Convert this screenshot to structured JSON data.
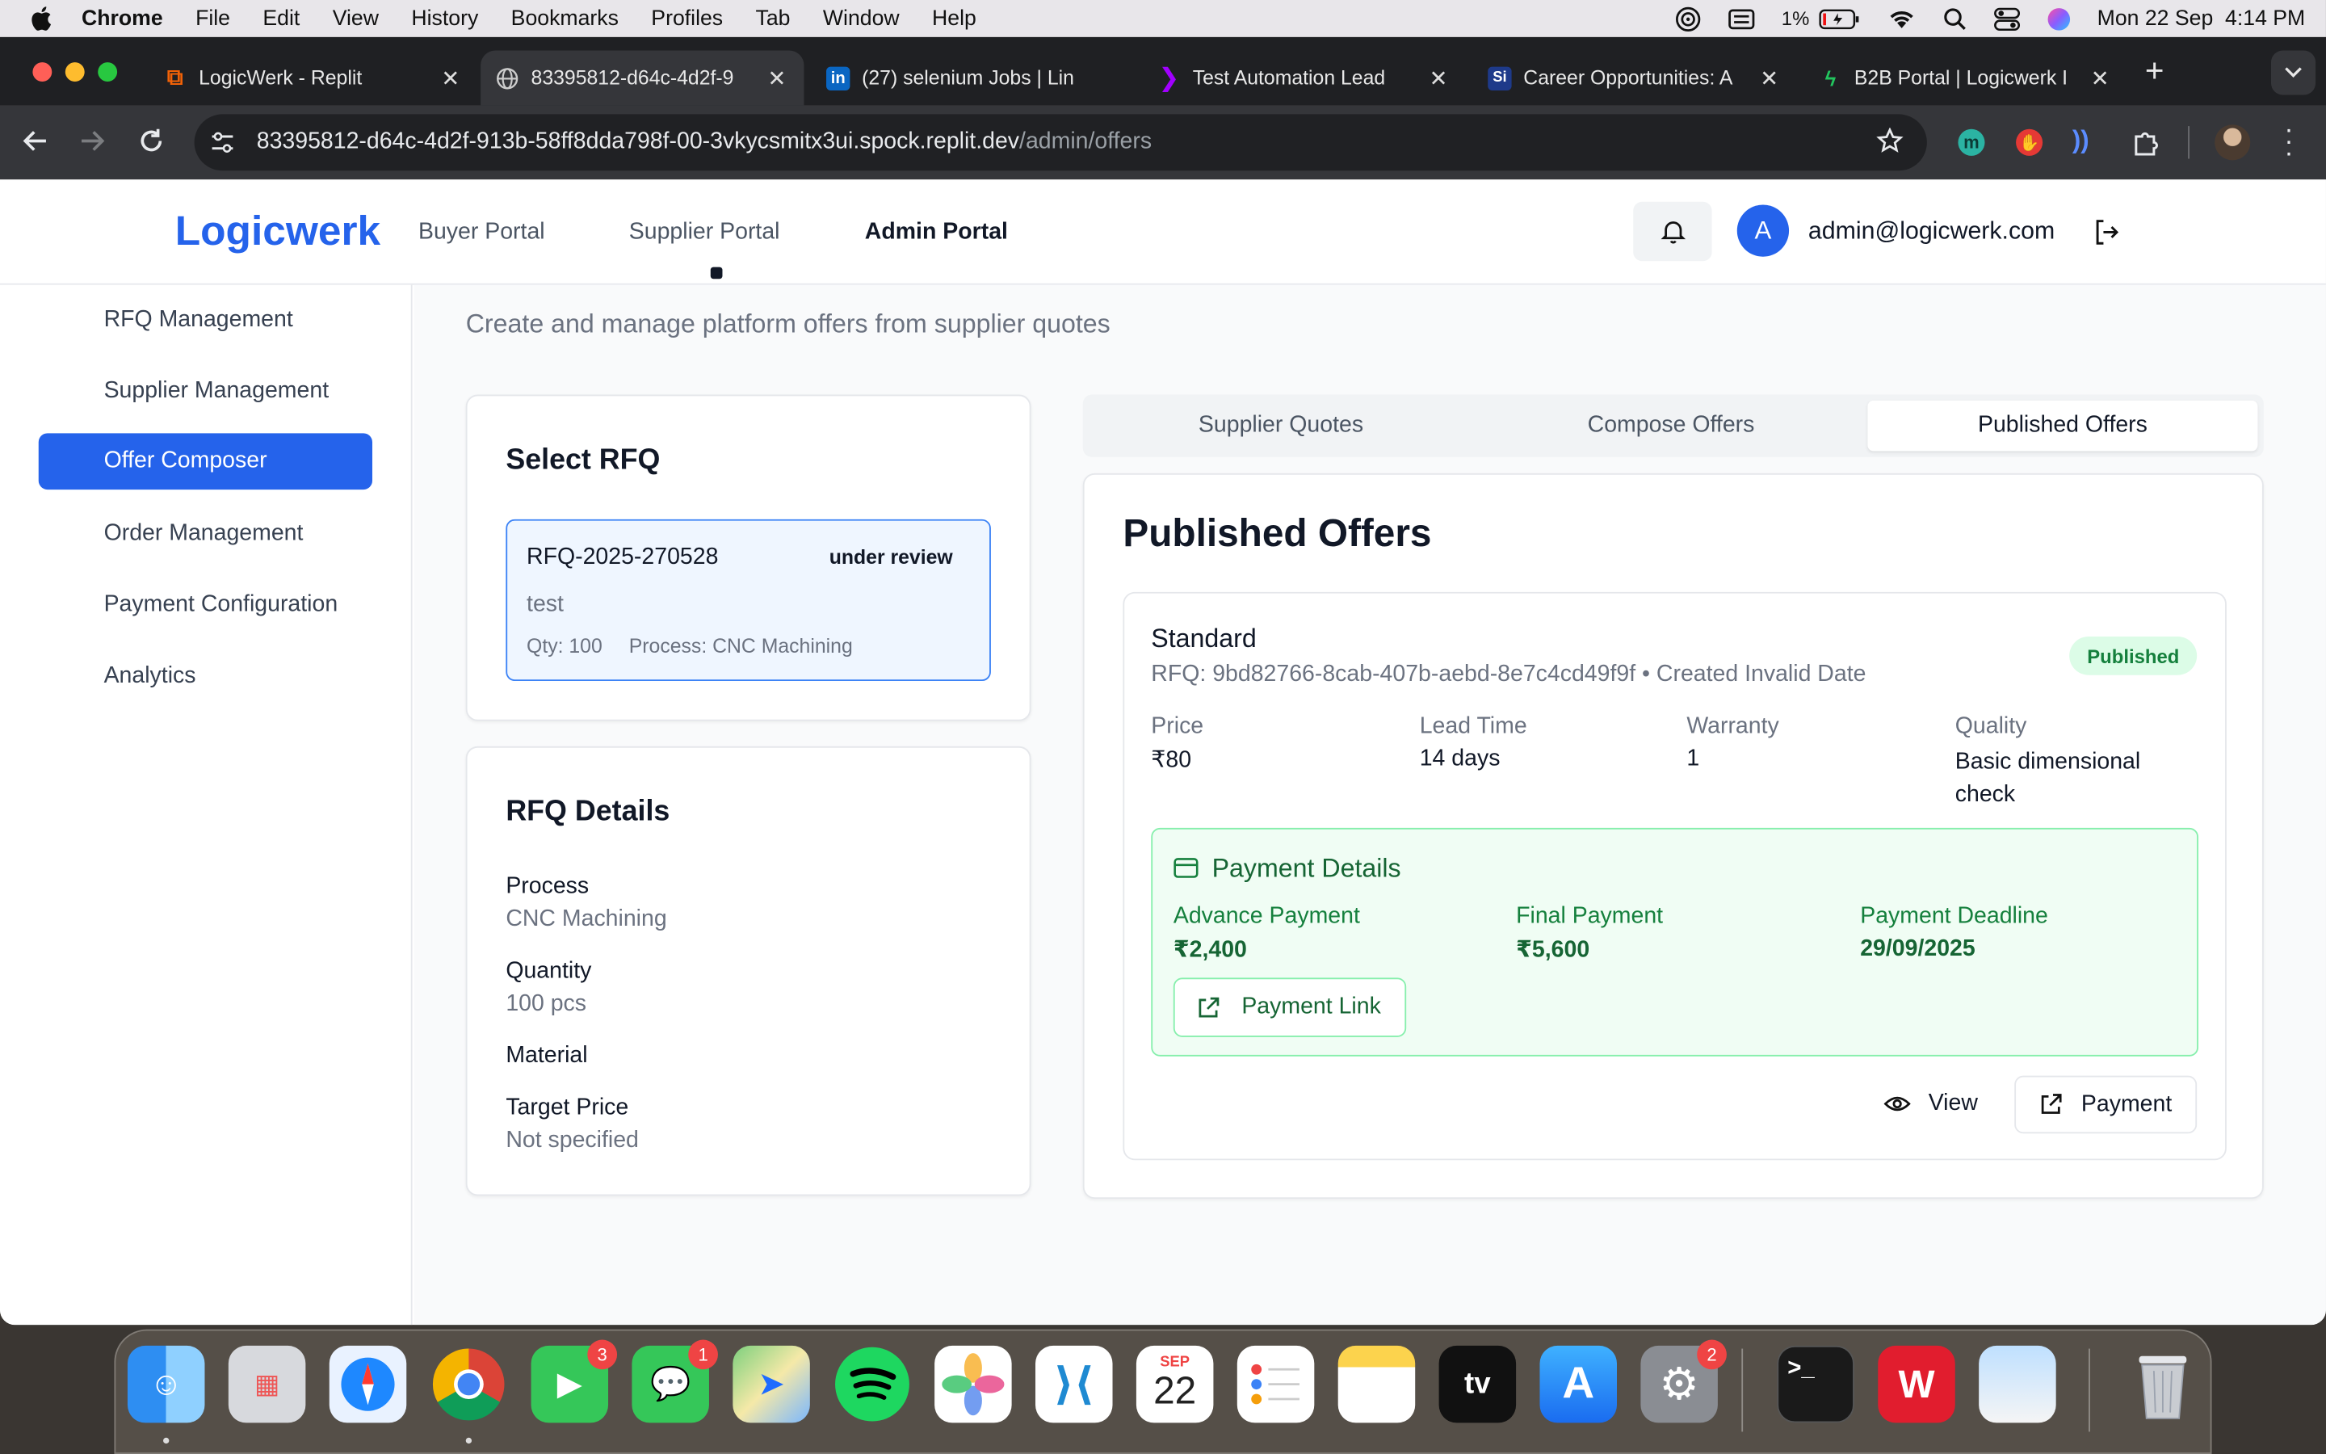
{
  "menubar": {
    "app": "Chrome",
    "items": [
      "File",
      "Edit",
      "View",
      "History",
      "Bookmarks",
      "Profiles",
      "Tab",
      "Window",
      "Help"
    ],
    "battery": "1%",
    "datetime": "Mon 22 Sep  4:14 PM"
  },
  "tabs": [
    {
      "title": "LogicWerk - Replit"
    },
    {
      "title": "83395812-d64c-4d2f-9"
    },
    {
      "title": "(27) selenium Jobs | Lin"
    },
    {
      "title": "Test Automation Lead"
    },
    {
      "title": "Career Opportunities: A"
    },
    {
      "title": "B2B Portal | Logicwerk I"
    }
  ],
  "address": {
    "host": "83395812-d64c-4d2f-913b-58ff8dda798f-00-3vkycsmitx3ui.spock.replit.dev",
    "path": "/admin/offers"
  },
  "header": {
    "brand": "Logicwerk",
    "nav": [
      "Buyer Portal",
      "Supplier Portal",
      "Admin Portal"
    ],
    "avatar_initial": "A",
    "user_email": "admin@logicwerk.com"
  },
  "sidebar": {
    "items": [
      {
        "label": "RFQ Management"
      },
      {
        "label": "Supplier Management"
      },
      {
        "label": "Offer Composer"
      },
      {
        "label": "Order Management"
      },
      {
        "label": "Payment Configuration"
      },
      {
        "label": "Analytics"
      }
    ]
  },
  "page": {
    "subtitle": "Create and manage platform offers from supplier quotes"
  },
  "select_rfq": {
    "title": "Select RFQ",
    "rfq_id": "RFQ-2025-270528",
    "status": "under review",
    "name": "test",
    "qty": "Qty: 100",
    "process": "Process: CNC Machining"
  },
  "rfq_details": {
    "title": "RFQ Details",
    "process_label": "Process",
    "process_value": "CNC Machining",
    "quantity_label": "Quantity",
    "quantity_value": "100 pcs",
    "material_label": "Material",
    "target_price_label": "Target Price",
    "target_price_value": "Not specified"
  },
  "tabs_main": [
    "Supplier Quotes",
    "Compose Offers",
    "Published Offers"
  ],
  "published": {
    "title": "Published Offers",
    "offer": {
      "name": "Standard",
      "meta": "RFQ: 9bd82766-8cab-407b-aebd-8e7c4cd49f9f • Created Invalid Date",
      "status": "Published",
      "price_label": "Price",
      "price_value": "₹80",
      "lead_label": "Lead Time",
      "lead_value": "14 days",
      "warranty_label": "Warranty",
      "warranty_value": "1",
      "quality_label": "Quality",
      "quality_value": "Basic dimensional check",
      "payment": {
        "title": "Payment Details",
        "advance_label": "Advance Payment",
        "advance_value": "₹2,400",
        "final_label": "Final Payment",
        "final_value": "₹5,600",
        "deadline_label": "Payment Deadline",
        "deadline_value": "29/09/2025",
        "link_label": "Payment Link"
      },
      "view_label": "View",
      "payment_label": "Payment"
    }
  },
  "dock": {
    "badges": {
      "facetime": "3",
      "messages": "1",
      "settings": "2"
    },
    "calendar_month": "SEP",
    "calendar_day": "22",
    "appletv": "tv"
  },
  "colors": {
    "brand": "#2563eb",
    "published_bg": "#dcfce7",
    "published_text": "#15803d",
    "payment_bg": "#f0fdf4",
    "payment_border": "#86efac"
  }
}
